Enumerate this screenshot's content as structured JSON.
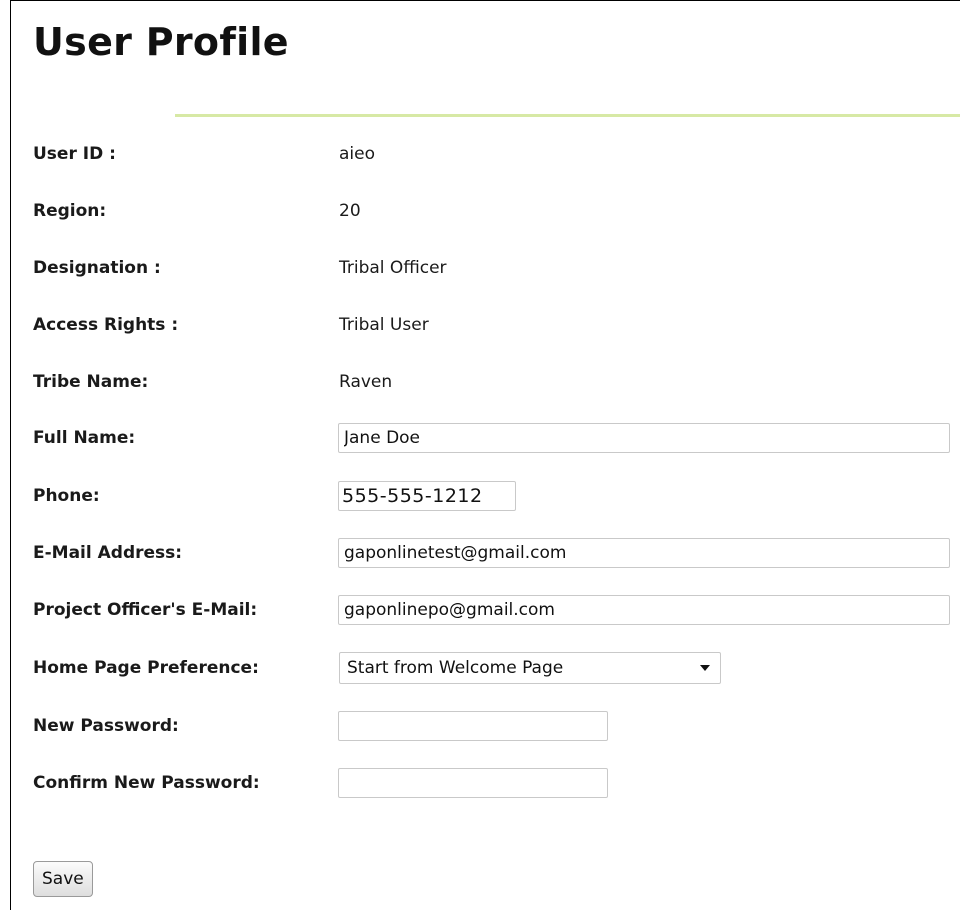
{
  "page": {
    "title": "User Profile"
  },
  "info": {
    "user_id": {
      "label": "User ID :",
      "value": "aieo"
    },
    "region": {
      "label": "Region:",
      "value": "20"
    },
    "designation": {
      "label": "Designation :",
      "value": "Tribal Officer"
    },
    "access_rights": {
      "label": "Access Rights :",
      "value": "Tribal User"
    },
    "tribe_name": {
      "label": "Tribe Name:",
      "value": "Raven"
    }
  },
  "form": {
    "full_name": {
      "label": "Full Name:",
      "value": "Jane Doe"
    },
    "phone": {
      "label": "Phone:",
      "value": "555-555-1212"
    },
    "email": {
      "label": "E-Mail Address:",
      "value": "gaponlinetest@gmail.com"
    },
    "po_email": {
      "label": "Project Officer's E-Mail:",
      "value": "gaponlinepo@gmail.com"
    },
    "home_page": {
      "label": "Home Page Preference:",
      "selected": "Start from Welcome Page"
    },
    "new_password": {
      "label": "New Password:",
      "value": ""
    },
    "confirm_password": {
      "label": "Confirm New Password:",
      "value": ""
    }
  },
  "actions": {
    "save_label": "Save"
  },
  "colors": {
    "rule": "#d7e9a5",
    "border": "#c9c9c9"
  }
}
